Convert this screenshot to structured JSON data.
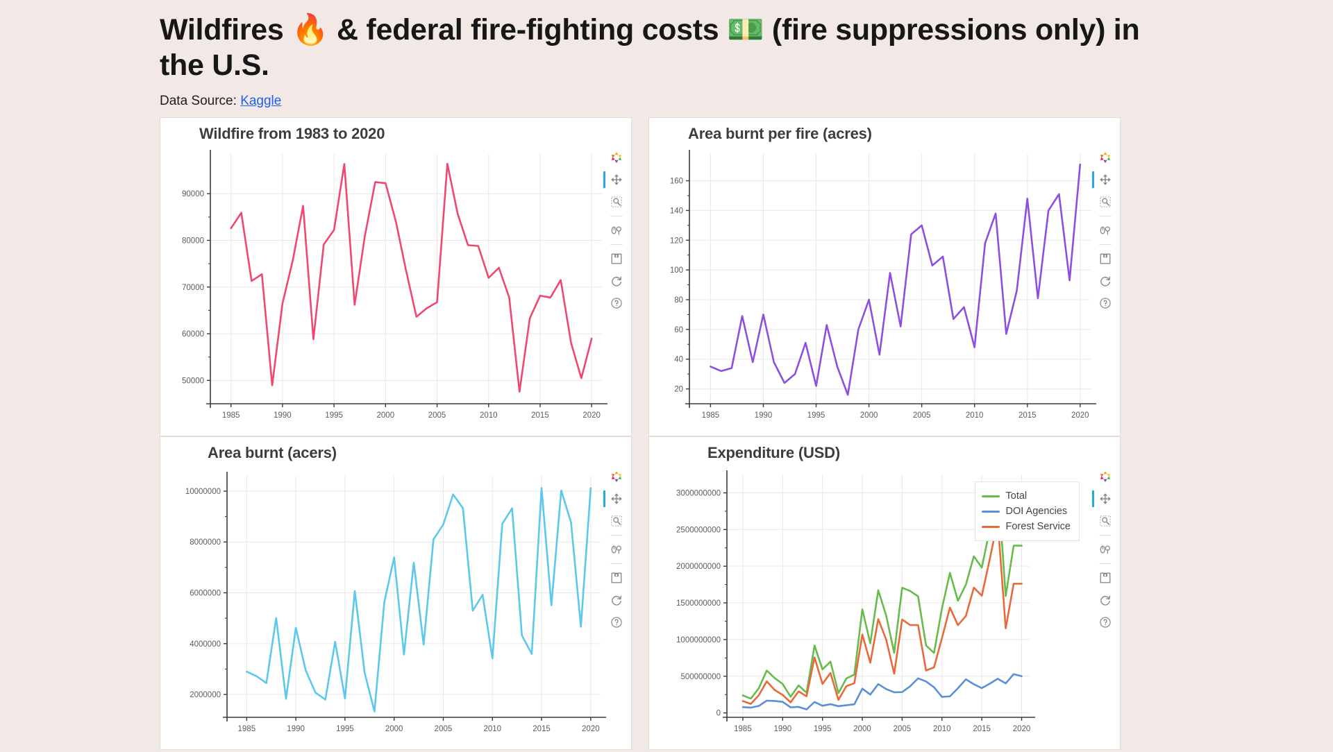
{
  "header": {
    "title": "Wildfires 🔥 & federal fire-fighting costs 💵 (fire suppressions only) in the U.S.",
    "datasource_label": "Data Source:",
    "datasource_link": "Kaggle"
  },
  "toolbar": {
    "logo": "bokeh-logo-icon",
    "pan": "pan-move-icon",
    "box_zoom": "box-zoom-icon",
    "wheel_zoom": "wheel-zoom-icon",
    "save": "save-disk-icon",
    "reset": "reset-refresh-icon",
    "help": "help-question-icon"
  },
  "chart_data": [
    {
      "id": "wildfire-count",
      "type": "line",
      "title": "Wildfire from 1983 to 2020",
      "xlabel": "",
      "ylabel": "",
      "color": "#ef476f",
      "xlim": [
        1983,
        2021
      ],
      "ylim": [
        45000,
        98500
      ],
      "xticks": [
        1985,
        1990,
        1995,
        2000,
        2005,
        2010,
        2015,
        2020
      ],
      "yticks": [
        50000,
        60000,
        70000,
        80000,
        90000
      ],
      "grid": true,
      "x": [
        1985,
        1986,
        1987,
        1988,
        1989,
        1990,
        1991,
        1992,
        1993,
        1994,
        1995,
        1996,
        1997,
        1998,
        1999,
        2000,
        2001,
        2002,
        2003,
        2004,
        2005,
        2006,
        2007,
        2008,
        2009,
        2010,
        2011,
        2012,
        2013,
        2014,
        2015,
        2016,
        2017,
        2018,
        2019,
        2020
      ],
      "values": [
        82591,
        85907,
        71300,
        72750,
        48949,
        66481,
        75754,
        87394,
        58810,
        79107,
        82234,
        96363,
        66196,
        81043,
        92487,
        92250,
        84079,
        73457,
        63629,
        65461,
        66753,
        96385,
        85705,
        78979,
        78792,
        71971,
        74126,
        67774,
        47579,
        63312,
        68151,
        67743,
        71499,
        58083,
        50477,
        58950
      ]
    },
    {
      "id": "area-per-fire",
      "type": "line",
      "title": "Area burnt per fire (acres)",
      "xlabel": "",
      "ylabel": "",
      "color": "#8e4ee0",
      "xlim": [
        1983,
        2021
      ],
      "ylim": [
        10,
        178
      ],
      "xticks": [
        1985,
        1990,
        1995,
        2000,
        2005,
        2010,
        2015,
        2020
      ],
      "yticks": [
        20,
        40,
        60,
        80,
        100,
        120,
        140,
        160
      ],
      "grid": true,
      "x": [
        1985,
        1986,
        1987,
        1988,
        1989,
        1990,
        1991,
        1992,
        1993,
        1994,
        1995,
        1996,
        1997,
        1998,
        1999,
        2000,
        2001,
        2002,
        2003,
        2004,
        2005,
        2006,
        2007,
        2008,
        2009,
        2010,
        2011,
        2012,
        2013,
        2014,
        2015,
        2016,
        2017,
        2018,
        2019,
        2020
      ],
      "values": [
        35,
        32,
        34,
        69,
        38,
        70,
        38,
        24,
        30,
        51,
        22,
        63,
        35,
        16,
        60,
        80,
        43,
        98,
        62,
        124,
        130,
        103,
        109,
        67,
        75,
        48,
        118,
        138,
        57,
        86,
        148,
        81,
        140,
        151,
        93,
        171
      ]
    },
    {
      "id": "area-burnt",
      "type": "line",
      "title": "Area burnt (acers)",
      "xlabel": "",
      "ylabel": "",
      "color": "#5bc8ec",
      "xlim": [
        1983,
        2021
      ],
      "ylim": [
        1100000,
        10600000
      ],
      "xticks": [
        1985,
        1990,
        1995,
        2000,
        2005,
        2010,
        2015,
        2020
      ],
      "yticks": [
        2000000,
        4000000,
        6000000,
        8000000,
        10000000
      ],
      "grid": true,
      "x": [
        1985,
        1986,
        1987,
        1988,
        1989,
        1990,
        1991,
        1992,
        1993,
        1994,
        1995,
        1996,
        1997,
        1998,
        1999,
        2000,
        2001,
        2002,
        2003,
        2004,
        2005,
        2006,
        2007,
        2008,
        2009,
        2010,
        2011,
        2012,
        2013,
        2014,
        2015,
        2016,
        2017,
        2018,
        2019,
        2020
      ],
      "values": [
        2896147,
        2719162,
        2447296,
        5009290,
        1827310,
        4621621,
        2953578,
        2069929,
        1797409,
        4073579,
        1840546,
        6065998,
        2856959,
        1329704,
        5626093,
        7393493,
        3570911,
        7184712,
        3960842,
        8097880,
        8689389,
        9873745,
        9328045,
        5292468,
        5921786,
        3422724,
        8711367,
        9326238,
        4319546,
        3595613,
        10125149,
        5509995,
        10026086,
        8767492,
        4664364,
        10122336
      ]
    },
    {
      "id": "expenditure",
      "type": "line",
      "title": "Expenditure (USD)",
      "xlabel": "",
      "ylabel": "",
      "xlim": [
        1983,
        2021
      ],
      "ylim": [
        -60000000,
        3250000000
      ],
      "xticks": [
        1985,
        1990,
        1995,
        2000,
        2005,
        2010,
        2015,
        2020
      ],
      "yticks": [
        0,
        500000000,
        1000000000,
        1500000000,
        2000000000,
        2500000000,
        3000000000
      ],
      "grid": true,
      "legend_position": "top-right",
      "x": [
        1985,
        1986,
        1987,
        1988,
        1989,
        1990,
        1991,
        1992,
        1993,
        1994,
        1995,
        1996,
        1997,
        1998,
        1999,
        2000,
        2001,
        2002,
        2003,
        2004,
        2005,
        2006,
        2007,
        2008,
        2009,
        2010,
        2011,
        2012,
        2013,
        2014,
        2015,
        2016,
        2017,
        2018,
        2019,
        2020
      ],
      "series": [
        {
          "name": "Total",
          "color": "#66bb4a",
          "values": [
            239000000,
            195000000,
            335000000,
            578000000,
            475000000,
            395000000,
            220000000,
            375000000,
            275000000,
            918000000,
            593000000,
            700000000,
            270000000,
            470000000,
            523000000,
            1411000000,
            948000000,
            1672000000,
            1324000000,
            820000000,
            1707000000,
            1662000000,
            1589000000,
            919000000,
            818000000,
            1427000000,
            1909000000,
            1528000000,
            1748000000,
            2135000000,
            1982000000,
            2503000000,
            3143000000,
            1593000000,
            2280000000,
            2280000000
          ]
        },
        {
          "name": "DOI Agencies",
          "color": "#5b8fd8",
          "values": [
            79000000,
            72000000,
            95000000,
            167000000,
            163000000,
            151000000,
            76000000,
            82000000,
            48000000,
            149000000,
            98000000,
            119000000,
            92000000,
            105000000,
            118000000,
            331000000,
            250000000,
            393000000,
            325000000,
            281000000,
            284000000,
            363000000,
            471000000,
            429000000,
            350000000,
            218000000,
            226000000,
            336000000,
            458000000,
            391000000,
            338000000,
            399000000,
            466000000,
            402000000,
            529000000,
            500000000
          ]
        },
        {
          "name": "Forest Service",
          "color": "#e8693a",
          "values": [
            161000000,
            123000000,
            240000000,
            430000000,
            312000000,
            245000000,
            144000000,
            293000000,
            227000000,
            757000000,
            395000000,
            545000000,
            178000000,
            365000000,
            405000000,
            1069000000,
            684000000,
            1279000000,
            999000000,
            534000000,
            1273000000,
            1198000000,
            1197000000,
            578000000,
            621000000,
            1021000000,
            1436000000,
            1196000000,
            1321000000,
            1708000000,
            1598000000,
            2097000000,
            2619000000,
            1152000000,
            1761000000,
            1761000000
          ]
        }
      ]
    }
  ]
}
